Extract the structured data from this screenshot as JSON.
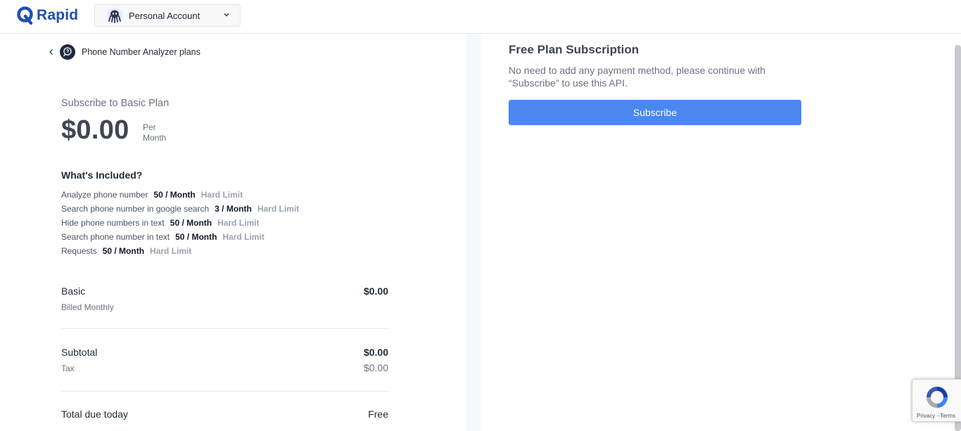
{
  "header": {
    "brand": "Rapid",
    "account_label": "Personal Account"
  },
  "left": {
    "back_label": "Phone Number Analyzer plans",
    "subscribe_title": "Subscribe to Basic Plan",
    "price": "$0.00",
    "per_line1": "Per",
    "per_line2": "Month",
    "included_title": "What's Included?",
    "features": [
      {
        "name": "Analyze phone number",
        "limit": "50 / Month",
        "type": "Hard Limit"
      },
      {
        "name": "Search phone number in google search",
        "limit": "3 / Month",
        "type": "Hard Limit"
      },
      {
        "name": "Hide phone numbers in text",
        "limit": "50 / Month",
        "type": "Hard Limit"
      },
      {
        "name": "Search phone number in text",
        "limit": "50 / Month",
        "type": "Hard Limit"
      },
      {
        "name": "Requests",
        "limit": "50 / Month",
        "type": "Hard Limit"
      }
    ],
    "plan_name": "Basic",
    "plan_price": "$0.00",
    "billing": "Billed Monthly",
    "subtotal_label": "Subtotal",
    "subtotal_value": "$0.00",
    "tax_label": "Tax",
    "tax_value": "$0.00",
    "total_label": "Total due today",
    "total_value": "Free"
  },
  "right": {
    "title": "Free Plan Subscription",
    "description": "No need to add any payment method, please continue with “Subscribe” to use this API.",
    "button_label": "Subscribe"
  },
  "recaptcha": {
    "links": "Privacy - Terms"
  },
  "colors": {
    "brand": "#1f4fb4",
    "button": "#4a87ef"
  }
}
